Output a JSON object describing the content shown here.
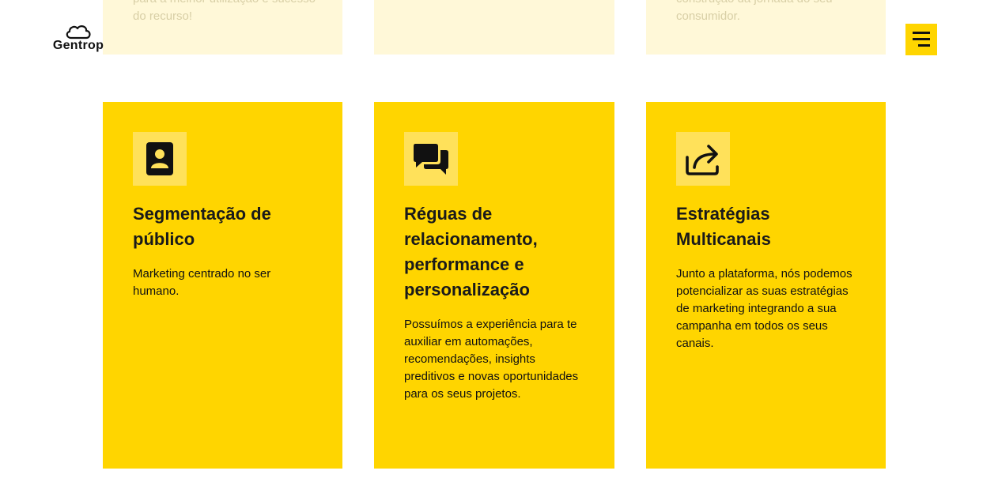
{
  "header": {
    "logo_text": "Gentrop",
    "logo_icon": "cloud-icon",
    "menu_icon": "hamburger-menu-icon"
  },
  "faded_row": [
    {
      "text": "para a melhor utilização e sucesso do recurso!"
    },
    {
      "text": ""
    },
    {
      "text": "construção da jornada do seu consumidor."
    }
  ],
  "cards": [
    {
      "icon": "contact-profile-icon",
      "title": "Segmentação de público",
      "text": "Marketing centrado no ser humano."
    },
    {
      "icon": "chat-bubbles-icon",
      "title": "Réguas de relacionamento, performance e personalização",
      "text": "Possuímos a experiência para te auxiliar em automações, recomendações, insights preditivos e novas oportunidades para os seus projetos."
    },
    {
      "icon": "share-arrow-icon",
      "title": "Estratégias Multicanais",
      "text": "Junto a plataforma, nós podemos potencializar as suas estratégias de marketing integrando a sua campanha em todos os seus canais."
    }
  ],
  "colors": {
    "accent": "#ffd500",
    "icon_bg": "#ffe15a",
    "faded_card": "#fff8d8",
    "text": "#111111"
  }
}
